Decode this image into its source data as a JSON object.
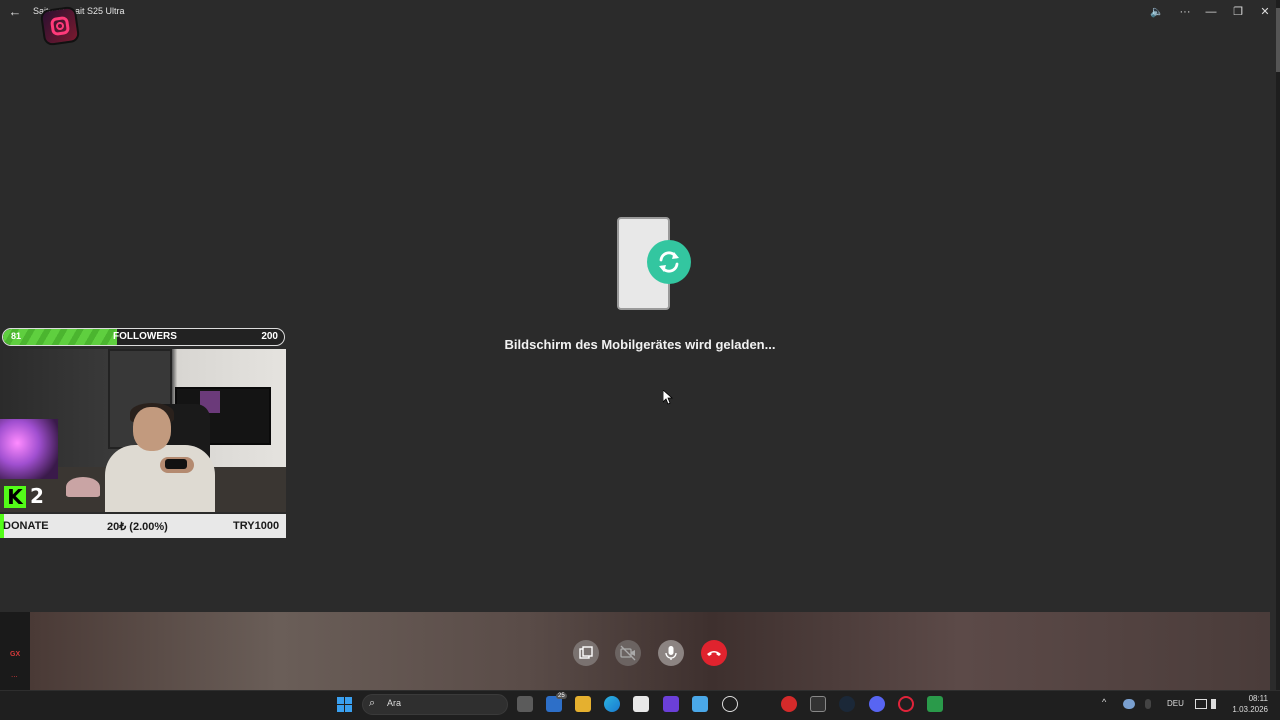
{
  "window": {
    "title": "Saitmaiye ait S25 Ultra",
    "back_icon": "arrow-left-icon",
    "controls": [
      "speaker-icon",
      "more-icon",
      "minimize-icon",
      "restore-icon",
      "close-icon"
    ]
  },
  "loading": {
    "message": "Bildschirm des Mobilgerätes wird geladen...",
    "icon": "phone-sync-icon"
  },
  "overlay": {
    "followers": {
      "current": "81",
      "label": "FOLLOWERS",
      "goal": "200",
      "progress": 0.405
    },
    "kick": {
      "logo": "K",
      "count": "2"
    },
    "donate": {
      "label": "DONATE",
      "amount": "20₺ (2.00%)",
      "code": "TRY1000"
    }
  },
  "call_controls": {
    "side_label": "GX",
    "side_dots": "...",
    "buttons": [
      "screen-share-icon",
      "video-off-icon",
      "microphone-icon",
      "hang-up-icon"
    ]
  },
  "taskbar": {
    "search_placeholder": "Ara",
    "apps": [
      "task-view-icon",
      "mail-icon",
      "file-explorer-icon",
      "edge-icon",
      "store-icon",
      "apps-icon",
      "phone-link-icon",
      "chatgpt-icon",
      "game-icon",
      "epic-games-icon",
      "steam-icon",
      "discord-icon",
      "opera-gx-icon",
      "obs-icon"
    ],
    "mail_badge": "25",
    "tray": {
      "language": "DEU",
      "time": "08:11",
      "date": "1.03.2026"
    }
  },
  "colors": {
    "background": "#2b2b2b",
    "sync_accent": "#33c6a0",
    "hangup": "#e0232e",
    "kick_green": "#53fc18"
  }
}
